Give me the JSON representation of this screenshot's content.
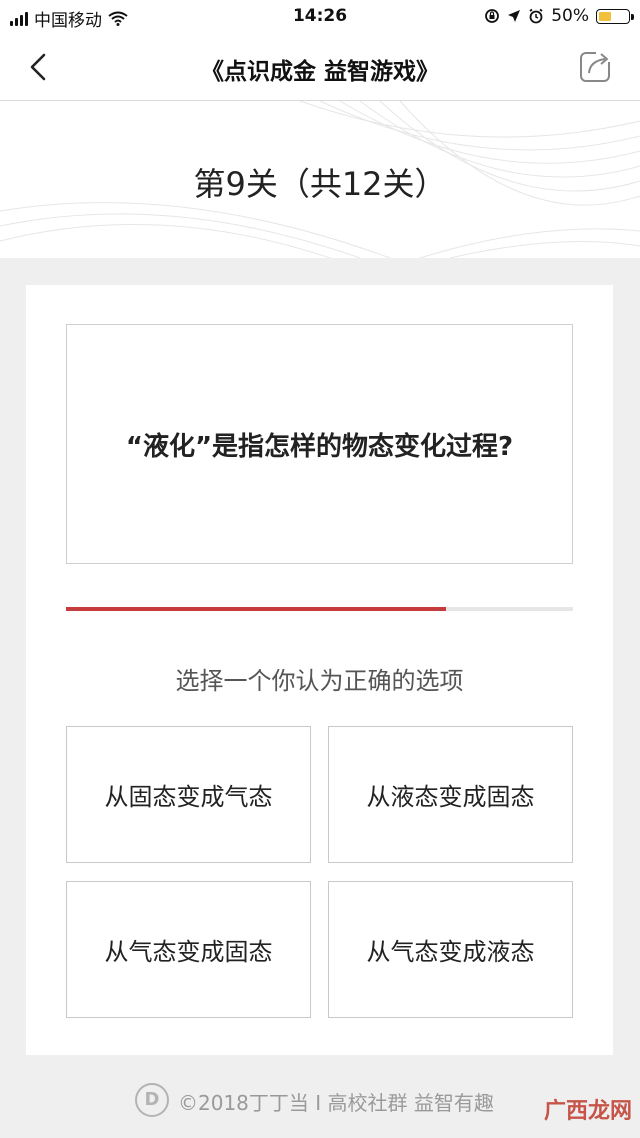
{
  "status_bar": {
    "carrier": "中国移动",
    "time": "14:26",
    "battery_percent": "50%",
    "battery_level": 0.5,
    "icons": [
      "signal-icon",
      "wifi-icon",
      "screen-lock-icon",
      "location-icon",
      "alarm-icon",
      "battery-icon"
    ]
  },
  "nav": {
    "title": "《点识成金 益智游戏》",
    "back_icon": "chevron-left-icon",
    "share_icon": "share-icon"
  },
  "level": {
    "title": "第9关（共12关）"
  },
  "question": {
    "text": "“液化”是指怎样的物态变化过程?"
  },
  "progress": {
    "fraction": 0.75,
    "color": "#c63b3b"
  },
  "instruction": "选择一个你认为正确的选项",
  "options": [
    {
      "label": "从固态变成气态"
    },
    {
      "label": "从液态变成固态"
    },
    {
      "label": "从气态变成固态"
    },
    {
      "label": "从气态变成液态"
    }
  ],
  "footer": {
    "logo_letter": "D",
    "text": "©2018丁丁当 I 高校社群 益智有趣"
  },
  "watermark": "广西龙网"
}
